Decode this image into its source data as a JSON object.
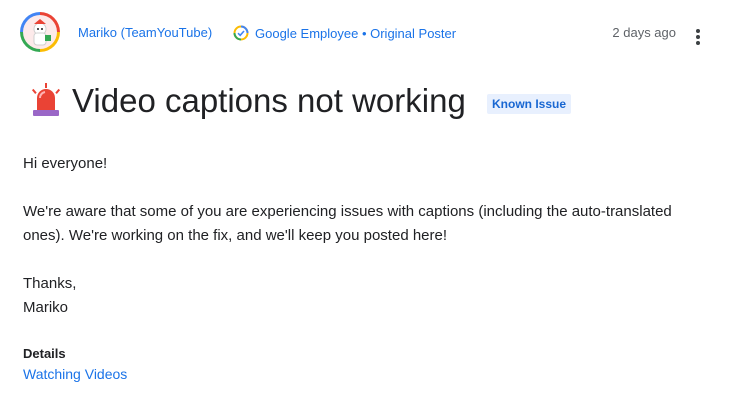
{
  "header": {
    "author": "Mariko (TeamYouTube)",
    "badge": "Google Employee • Original Poster",
    "time": "2 days ago"
  },
  "post": {
    "title": "Video captions not working",
    "status_chip": "Known Issue",
    "greeting": "Hi everyone!",
    "paragraph": "We're aware that some of you are experiencing issues with captions (including the auto-translated ones). We're working on the fix, and we'll keep you posted here!",
    "signoff_line1": "Thanks,",
    "signoff_line2": "Mariko"
  },
  "details": {
    "heading": "Details",
    "link": "Watching Videos"
  },
  "colors": {
    "link": "#1a73e8",
    "chip_bg": "#e8f0fe",
    "siren": "#ea4335"
  },
  "icons": {
    "avatar": "avatar-icon",
    "badge": "verified-check-icon",
    "more": "more-vert-icon",
    "siren": "siren-icon"
  }
}
